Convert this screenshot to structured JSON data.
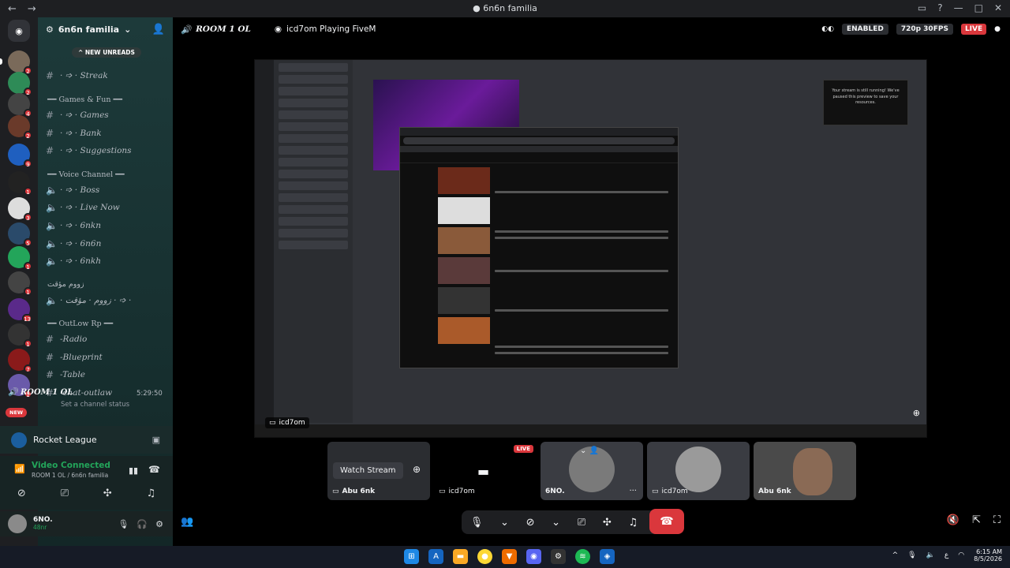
{
  "window": {
    "title": "6n6n familia"
  },
  "server": {
    "name": "6n6n familia"
  },
  "unread_pill": "NEW UNREADS",
  "channels": [
    {
      "name": "· ➩ · Streak",
      "top": 0
    },
    {
      "name": "· ➩ · Games"
    },
    {
      "name": "· ➩ · Bank"
    },
    {
      "name": "· ➩ · Suggestions"
    }
  ],
  "categories": {
    "games": "━━ Games & Fun ━━",
    "voice": "━━ Voice Channel ━━",
    "zoom": "زووم مؤقت",
    "outlow": "━━ OutLow Rp ━━"
  },
  "voice_channels": [
    "· ➩ · Boss",
    "· ➩ · Live Now",
    "· ➩ · 6nkn",
    "· ➩ · 6n6n",
    "· ➩ · 6nkh",
    "· زووم · مؤقت · ➩ ·"
  ],
  "outlow_channels": [
    "-Radio",
    "-Blueprint",
    "-Table",
    "-chat-outlaw"
  ],
  "active_voice": {
    "name": "ROOM 1 OL",
    "timer": "5:29:50",
    "status": "Set a channel status"
  },
  "new_badge": "NEW",
  "activity": {
    "game": "Rocket League"
  },
  "voice_panel": {
    "title": "Video Connected",
    "subtitle": "ROOM 1 OL / 6n6n familia"
  },
  "user": {
    "name": "6NO.",
    "status": "48nr"
  },
  "stage": {
    "room": "ROOM 1 OL",
    "playing": "icd7om Playing FiveM",
    "enabled": "ENABLED",
    "quality": "720p 30FPS",
    "live": "LIVE",
    "stream_user": "icd7om",
    "notice": "Your stream is still running! We've paused this preview to save your resources."
  },
  "tiles": [
    {
      "button": "Watch Stream",
      "user": "Abu 6nk"
    },
    {
      "user": "icd7om",
      "badge": "LIVE"
    },
    {
      "user": "6NO."
    },
    {
      "user": "icd7om"
    },
    {
      "user": "Abu 6nk"
    }
  ],
  "clock": {
    "time": "6:15 AM",
    "date": "8/5/2026",
    "lang": "ع"
  }
}
